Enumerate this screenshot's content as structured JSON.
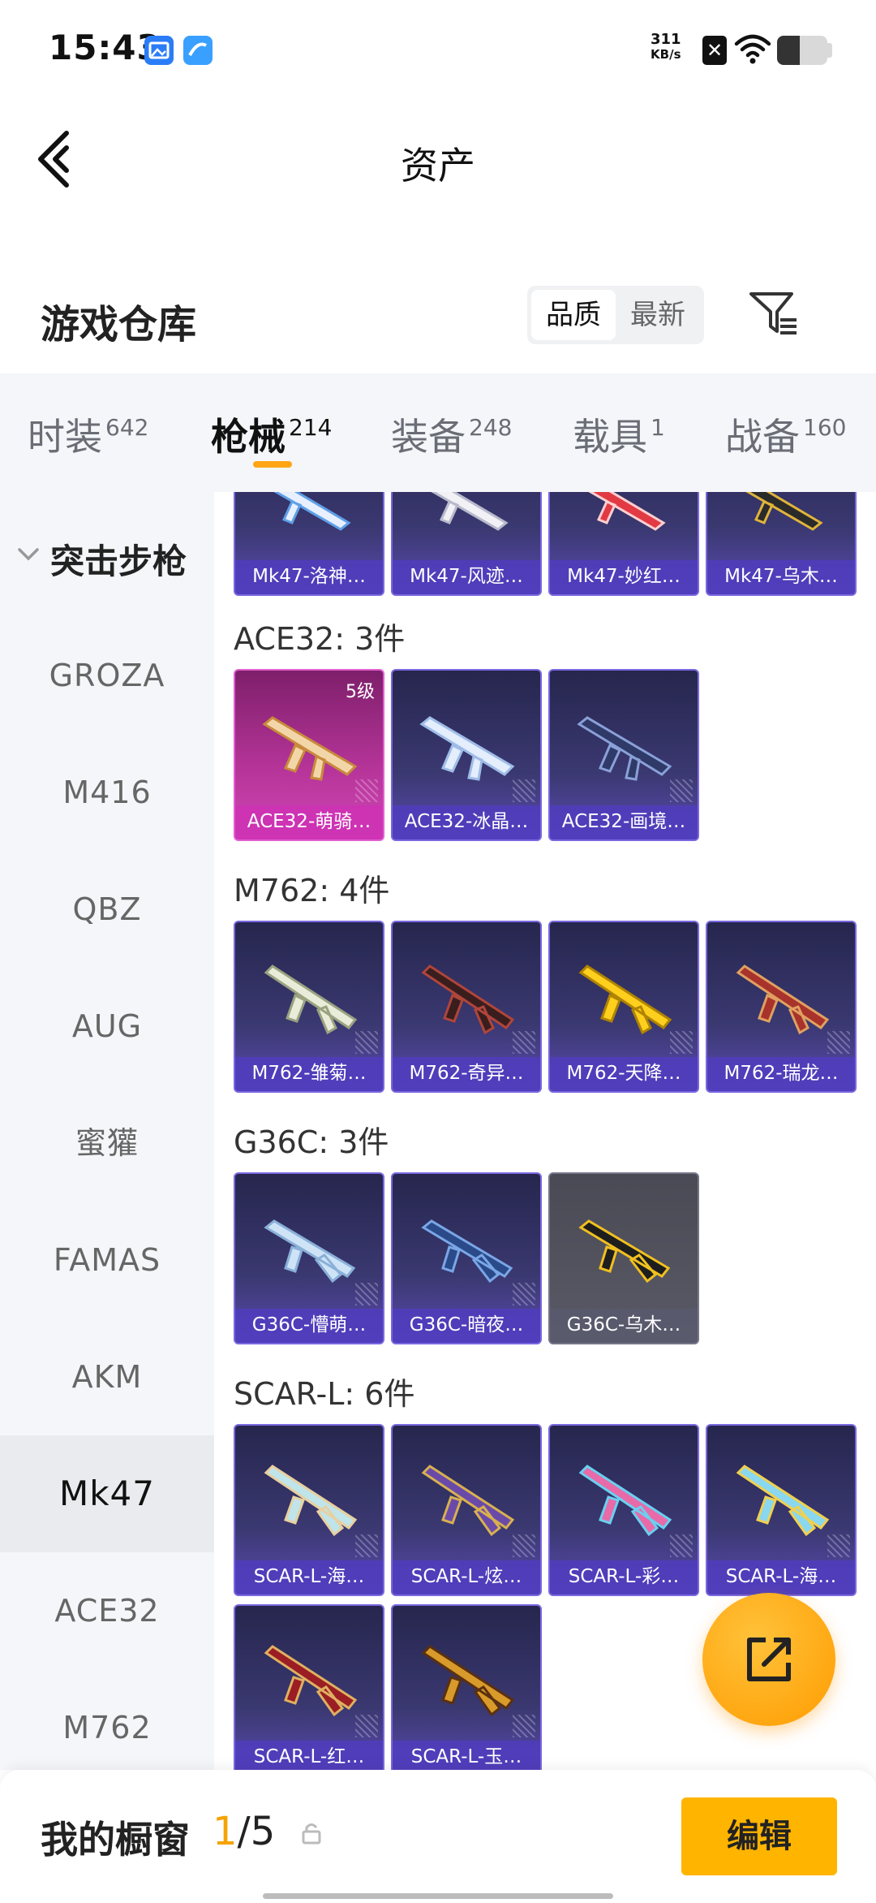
{
  "status_bar": {
    "time": "15:43",
    "net_speed_value": "311",
    "net_speed_unit": "KB/s",
    "battery_level": 0.45,
    "icons": [
      "gallery-notification-icon",
      "browser-notification-icon",
      "sim-off-icon",
      "wifi-icon",
      "battery-icon"
    ]
  },
  "header": {
    "title": "资产",
    "back_icon": "chevron-left-icon"
  },
  "warehouse": {
    "title": "游戏仓库",
    "sort_options": [
      "品质",
      "最新"
    ],
    "sort_selected": "品质",
    "filter_icon": "filter-icon"
  },
  "categories": [
    {
      "label": "时装",
      "count": "642"
    },
    {
      "label": "枪械",
      "count": "214"
    },
    {
      "label": "装备",
      "count": "248"
    },
    {
      "label": "载具",
      "count": "1"
    },
    {
      "label": "战备",
      "count": "160"
    }
  ],
  "sidebar": {
    "group": "突击步枪",
    "items": [
      "GROZA",
      "M416",
      "QBZ",
      "AUG",
      "蜜獾",
      "FAMAS",
      "AKM",
      "Mk47",
      "ACE32",
      "M762"
    ],
    "selected": "Mk47"
  },
  "groups": {
    "mk47": {
      "items": [
        "Mk47-洛神…",
        "Mk47-风迹…",
        "Mk47-妙红…",
        "Mk47-乌木…"
      ]
    },
    "ace32": {
      "title": "ACE32: 3件",
      "items": [
        "ACE32-萌骑…",
        "ACE32-冰晶…",
        "ACE32-画境…"
      ],
      "badge": "5级"
    },
    "m762": {
      "title": "M762: 4件",
      "items": [
        "M762-雏菊…",
        "M762-奇异…",
        "M762-天降…",
        "M762-瑞龙…"
      ]
    },
    "g36c": {
      "title": "G36C: 3件",
      "items": [
        "G36C-懵萌…",
        "G36C-暗夜…",
        "G36C-乌木…"
      ]
    },
    "scarl": {
      "title": "SCAR-L: 6件",
      "items": [
        "SCAR-L-海…",
        "SCAR-L-炫…",
        "SCAR-L-彩…",
        "SCAR-L-海…",
        "SCAR-L-红…",
        "SCAR-L-玉…"
      ]
    }
  },
  "colors": {
    "accent": "#ffa514",
    "card_purple": "#5a4bb1",
    "card_gold": "#d047b6"
  },
  "bottom_bar": {
    "label": "我的橱窗",
    "current": "1",
    "total": "/5",
    "edit_label": "编辑",
    "share_icon": "share-icon",
    "lock_icon": "lock-icon"
  }
}
